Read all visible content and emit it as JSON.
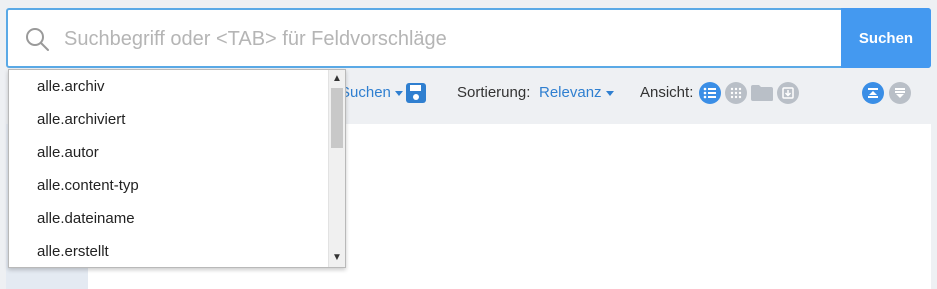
{
  "search": {
    "placeholder": "Suchbegriff oder <TAB> für Feldvorschläge",
    "button_label": "Suchen"
  },
  "toolbar": {
    "suchen_link": "Suchen",
    "sort_label": "Sortierung:",
    "sort_value": "Relevanz",
    "view_label": "Ansicht:"
  },
  "content": {
    "ghost_line": "... ........"
  },
  "dropdown": {
    "items": [
      {
        "label": "alle.archiv"
      },
      {
        "label": "alle.archiviert"
      },
      {
        "label": "alle.autor"
      },
      {
        "label": "alle.content-typ"
      },
      {
        "label": "alle.dateiname"
      },
      {
        "label": "alle.erstellt"
      }
    ]
  },
  "colors": {
    "accent": "#4499f0",
    "link": "#2f7fd0",
    "icon_active": "#3a8ee6",
    "icon_inactive": "#b9bfc7"
  }
}
